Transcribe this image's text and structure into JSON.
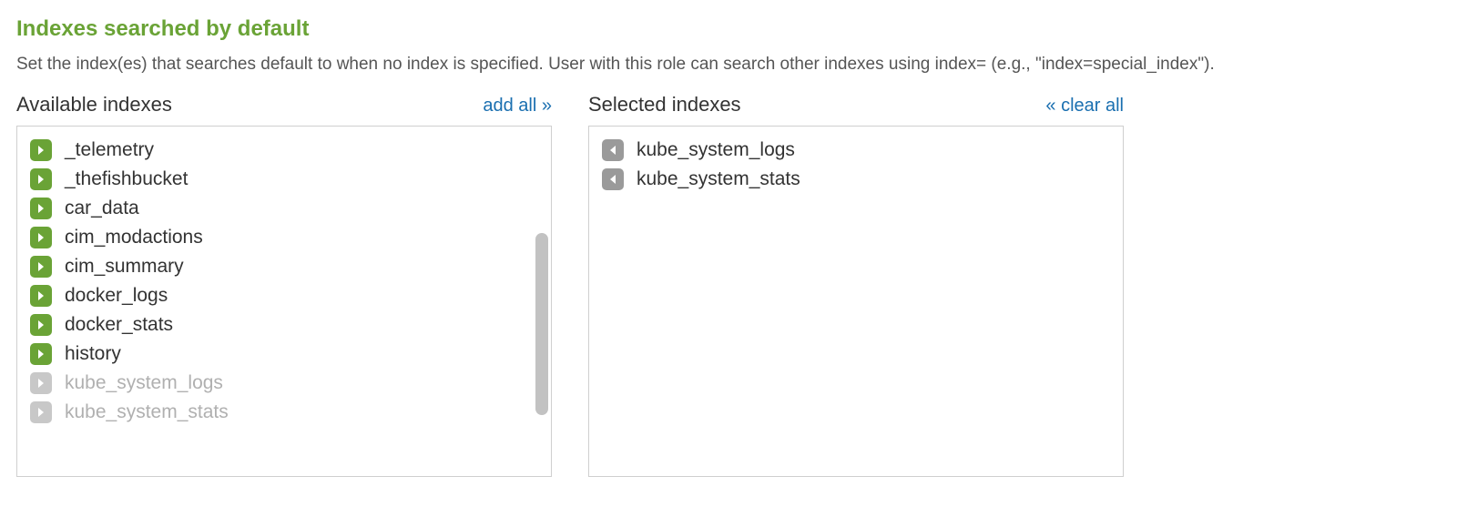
{
  "section": {
    "title": "Indexes searched by default",
    "description": "Set the index(es) that searches default to when no index is specified. User with this role can search other indexes using index= (e.g., \"index=special_index\")."
  },
  "available": {
    "header": "Available indexes",
    "action": "add all »",
    "items": [
      {
        "label": "_telemetry",
        "enabled": true
      },
      {
        "label": "_thefishbucket",
        "enabled": true
      },
      {
        "label": "car_data",
        "enabled": true
      },
      {
        "label": "cim_modactions",
        "enabled": true
      },
      {
        "label": "cim_summary",
        "enabled": true
      },
      {
        "label": "docker_logs",
        "enabled": true
      },
      {
        "label": "docker_stats",
        "enabled": true
      },
      {
        "label": "history",
        "enabled": true
      },
      {
        "label": "kube_system_logs",
        "enabled": false
      },
      {
        "label": "kube_system_stats",
        "enabled": false
      }
    ]
  },
  "selected": {
    "header": "Selected indexes",
    "action": "« clear all",
    "items": [
      {
        "label": "kube_system_logs"
      },
      {
        "label": "kube_system_stats"
      }
    ]
  }
}
